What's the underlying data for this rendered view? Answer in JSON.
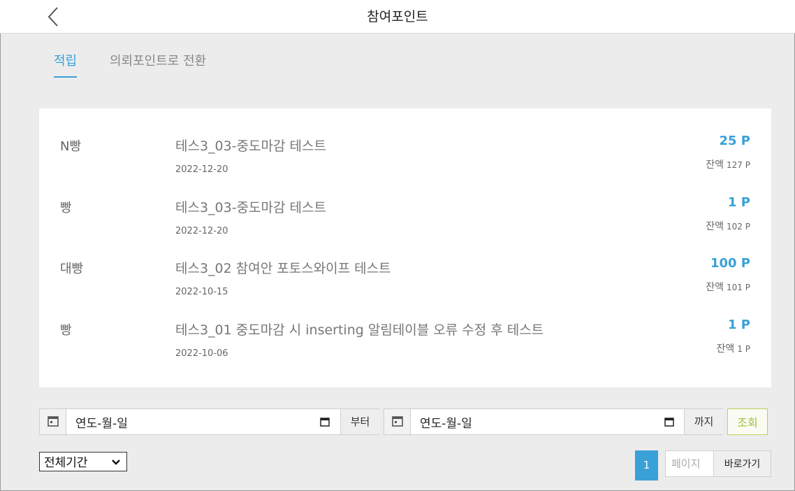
{
  "header": {
    "title": "참여포인트"
  },
  "tabs": [
    {
      "label": "적립"
    },
    {
      "label": "의뢰포인트로 전환"
    }
  ],
  "rows": [
    {
      "label": "N빵",
      "description": "테스3_03-중도마감 테스트",
      "date": "2022-12-20",
      "points": "25 P",
      "balance_label": "잔액",
      "balance": "127 P"
    },
    {
      "label": "빵",
      "description": "테스3_03-중도마감 테스트",
      "date": "2022-12-20",
      "points": "1 P",
      "balance_label": "잔액",
      "balance": "102 P"
    },
    {
      "label": "대빵",
      "description": "테스3_02 참여안 포토스와이프 테스트",
      "date": "2022-10-15",
      "points": "100 P",
      "balance_label": "잔액",
      "balance": "101 P"
    },
    {
      "label": "빵",
      "description": "테스3_01 중도마감 시 inserting 알림테이블 오류 수정 후 테스트",
      "date": "2022-10-06",
      "points": "1 P",
      "balance_label": "잔액",
      "balance": "1 P"
    }
  ],
  "filter": {
    "start_value": "연도-월-일",
    "start_suffix": "부터",
    "end_value": "연도-월-일",
    "end_suffix": "까지",
    "search_label": "조회",
    "period_selected": "전체기간"
  },
  "pagination": {
    "current_page": "1",
    "page_placeholder": "페이지",
    "goto_label": "바로가기"
  },
  "colors": {
    "accent": "#3aa0d8",
    "search_border": "#b7d458",
    "search_text": "#9dc33d"
  }
}
